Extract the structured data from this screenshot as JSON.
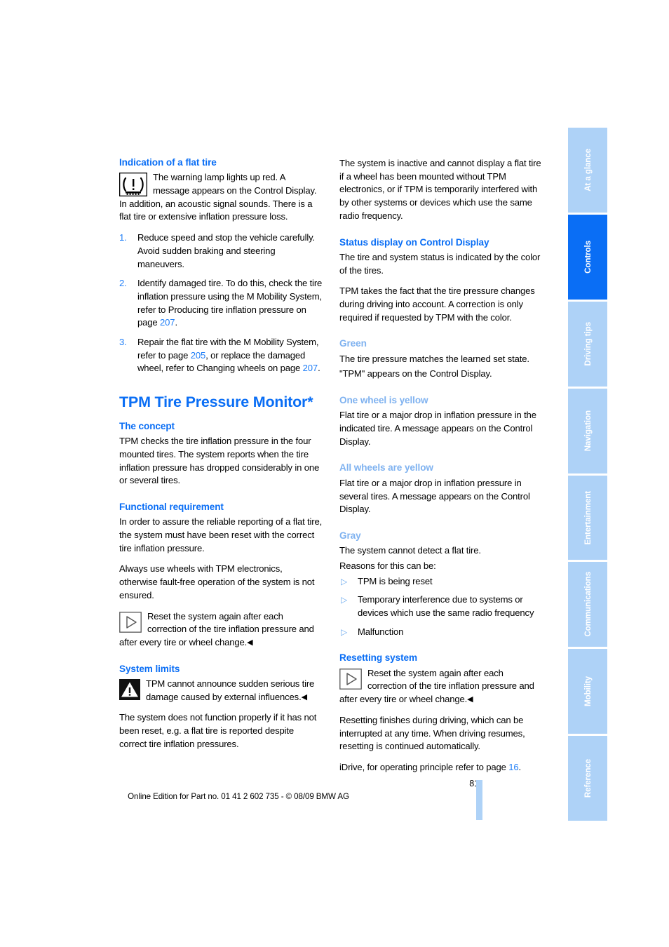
{
  "document": {
    "page_number": "81",
    "footer_text": "Online Edition for Part no. 01 41 2 602 735 - © 08/09 BMW AG"
  },
  "tabs": [
    {
      "label": "At a glance",
      "active": false
    },
    {
      "label": "Controls",
      "active": true
    },
    {
      "label": "Driving tips",
      "active": false
    },
    {
      "label": "Navigation",
      "active": false
    },
    {
      "label": "Entertainment",
      "active": false
    },
    {
      "label": "Communications",
      "active": false
    },
    {
      "label": "Mobility",
      "active": false
    },
    {
      "label": "Reference",
      "active": false
    }
  ],
  "colors": {
    "heading_blue": "#0a6ef5",
    "subheading_blue": "#7fb2f0",
    "tab_inactive": "#aed2f7",
    "reference_blue": "#1f7ef7"
  },
  "left_column": {
    "flat_tire_heading": "Indication of a flat tire",
    "flat_tire_note": "The warning lamp lights up red. A message appears on the Control Display. In addition, an acoustic signal sounds. There is a flat tire or extensive inflation pressure loss.",
    "steps": [
      {
        "num": "1.",
        "text": "Reduce speed and stop the vehicle carefully. Avoid sudden braking and steering maneuvers."
      },
      {
        "num": "2.",
        "text_a": "Identify damaged tire. To do this, check the tire inflation pressure using the M Mobility System, refer to Producing tire inflation pressure on page ",
        "ref": "207",
        "text_b": "."
      },
      {
        "num": "3.",
        "text_a": "Repair the flat tire with the M Mobility System, refer to page ",
        "ref1": "205",
        "text_b": ", or replace the damaged wheel, refer to Changing wheels on page ",
        "ref2": "207",
        "text_c": "."
      }
    ],
    "tpm_title": "TPM Tire Pressure Monitor*",
    "concept_heading": "The concept",
    "concept_body": "TPM checks the tire inflation pressure in the four mounted tires. The system reports when the tire inflation pressure has dropped considerably in one or several tires.",
    "functional_heading": "Functional requirement",
    "functional_p1": "In order to assure the reliable reporting of a flat tire, the system must have been reset with the correct tire inflation pressure.",
    "functional_p2": "Always use wheels with TPM electronics, otherwise fault-free operation of the system is not ensured.",
    "functional_note": "Reset the system again after each correction of the tire inflation pressure and after every tire or wheel change.",
    "functional_note_end": "◀",
    "limits_heading": "System limits",
    "limits_note": "TPM cannot announce sudden serious tire damage caused by external influences.",
    "limits_note_end": "◀",
    "limits_body": "The system does not function properly if it has not been reset, e.g. a flat tire is reported despite correct tire inflation pressures."
  },
  "right_column": {
    "inactive_body": "The system is inactive and cannot display a flat tire if a wheel has been mounted without TPM electronics, or if TPM is temporarily interfered with by other systems or devices which use the same radio frequency.",
    "status_heading": "Status display on Control Display",
    "status_p1": "The tire and system status is indicated by the color of the tires.",
    "status_p2": "TPM takes the fact that the tire pressure changes during driving into account. A correction is only required if requested by TPM with the color.",
    "green_heading": "Green",
    "green_p1": "The tire pressure matches the learned set state.",
    "green_p2": "\"TPM\" appears on the Control Display.",
    "one_yellow_heading": "One wheel is yellow",
    "one_yellow_body": "Flat tire or a major drop in inflation pressure in the indicated tire. A message appears on the Control Display.",
    "all_yellow_heading": "All wheels are yellow",
    "all_yellow_body": "Flat tire or a major drop in inflation pressure in several tires. A message appears on the Control Display.",
    "gray_heading": "Gray",
    "gray_p1": "The system cannot detect a flat tire.",
    "gray_p2": "Reasons for this can be:",
    "gray_bullets": [
      "TPM is being reset",
      "Temporary interference due to systems or devices which use the same radio frequency",
      "Malfunction"
    ],
    "reset_heading": "Resetting system",
    "reset_note": "Reset the system again after each correction of the tire inflation pressure and after every tire or wheel change.",
    "reset_note_end": "◀",
    "reset_p1": "Resetting finishes during driving, which can be interrupted at any time. When driving resumes, resetting is continued automatically.",
    "idrive_a": "iDrive, for operating principle refer to page ",
    "idrive_ref": "16",
    "idrive_b": "."
  }
}
